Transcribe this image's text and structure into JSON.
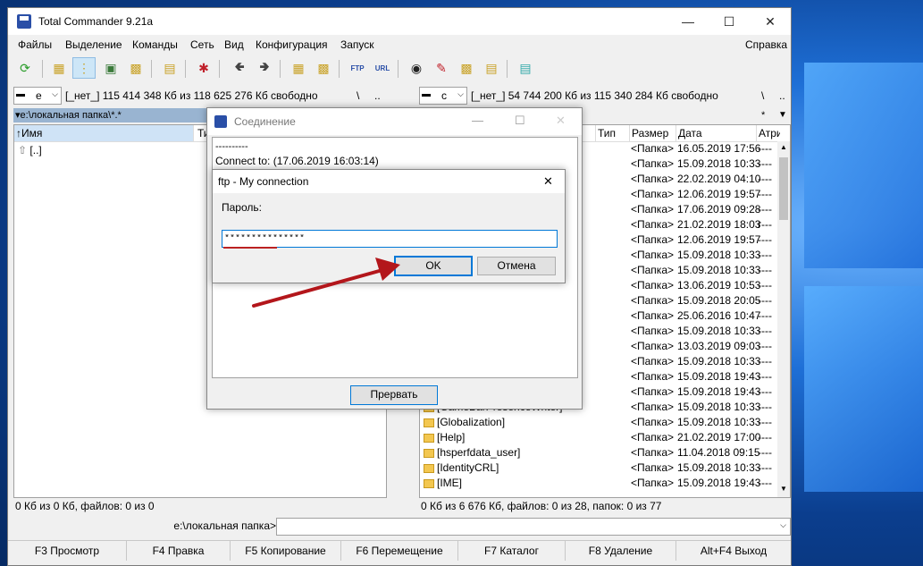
{
  "window": {
    "title": "Total Commander 9.21a"
  },
  "menu": {
    "items": [
      "Файлы",
      "Выделение",
      "Команды",
      "Сеть",
      "Вид",
      "Конфигурация",
      "Запуск"
    ],
    "help": "Справка"
  },
  "left": {
    "drive": "e",
    "drive_info": "[_нет_]  115 414 348 Кб из 118 625 276 Кб свободно",
    "root_btn": "\\",
    "up_btn": "..",
    "path": "▾e:\\локальная папка\\*.*",
    "col_name": "↑Имя",
    "col_type": "Тип",
    "parent_row": "[..]",
    "status": "0 Кб из 0 Кб, файлов: 0 из 0"
  },
  "right": {
    "drive": "c",
    "drive_info": "[_нет_]  54 744 200 Кб из 115 340 284 Кб свободно",
    "root_btn": "\\",
    "up_btn": "..",
    "path_star": "*",
    "col_type": "Тип",
    "col_size": "Размер",
    "col_date": "Дата",
    "col_attr": "Атриб",
    "rows": [
      {
        "name": "",
        "size": "<Папка>",
        "date": "16.05.2019 17:56",
        "attr": "----"
      },
      {
        "name": "",
        "size": "<Папка>",
        "date": "15.09.2018 10:33",
        "attr": "----"
      },
      {
        "name": "",
        "size": "<Папка>",
        "date": "22.02.2019 04:10",
        "attr": "----"
      },
      {
        "name": "",
        "size": "<Папка>",
        "date": "12.06.2019 19:57",
        "attr": "----"
      },
      {
        "name": "",
        "size": "<Папка>",
        "date": "17.06.2019 09:28",
        "attr": "----"
      },
      {
        "name": "",
        "size": "<Папка>",
        "date": "21.02.2019 18:03",
        "attr": "r---"
      },
      {
        "name": "",
        "size": "<Папка>",
        "date": "12.06.2019 19:57",
        "attr": "----"
      },
      {
        "name": "",
        "size": "<Папка>",
        "date": "15.09.2018 10:33",
        "attr": "----"
      },
      {
        "name": "",
        "size": "<Папка>",
        "date": "15.09.2018 10:33",
        "attr": "----"
      },
      {
        "name": "",
        "size": "<Папка>",
        "date": "13.06.2019 10:53",
        "attr": "----"
      },
      {
        "name": "",
        "size": "<Папка>",
        "date": "15.09.2018 20:05",
        "attr": "----"
      },
      {
        "name": "",
        "size": "<Папка>",
        "date": "25.06.2016 10:47",
        "attr": "----"
      },
      {
        "name": "",
        "size": "<Папка>",
        "date": "15.09.2018 10:33",
        "attr": "----"
      },
      {
        "name": "",
        "size": "<Папка>",
        "date": "13.03.2019 09:03",
        "attr": "----"
      },
      {
        "name": "",
        "size": "<Папка>",
        "date": "15.09.2018 10:33",
        "attr": "----"
      },
      {
        "name": "",
        "size": "<Папка>",
        "date": "15.09.2018 19:43",
        "attr": "----"
      },
      {
        "name": "",
        "size": "<Папка>",
        "date": "15.09.2018 19:43",
        "attr": "----"
      },
      {
        "name": "[GameBarPresenceWriter]",
        "size": "<Папка>",
        "date": "15.09.2018 10:33",
        "attr": "----"
      },
      {
        "name": "[Globalization]",
        "size": "<Папка>",
        "date": "15.09.2018 10:33",
        "attr": "----"
      },
      {
        "name": "[Help]",
        "size": "<Папка>",
        "date": "21.02.2019 17:00",
        "attr": "----"
      },
      {
        "name": "[hsperfdata_user]",
        "size": "<Папка>",
        "date": "11.04.2018 09:15",
        "attr": "----"
      },
      {
        "name": "[IdentityCRL]",
        "size": "<Папка>",
        "date": "15.09.2018 10:33",
        "attr": "----"
      },
      {
        "name": "[IME]",
        "size": "<Папка>",
        "date": "15.09.2018 19:43",
        "attr": "----"
      }
    ],
    "status": "0 Кб из 6 676 Кб, файлов: 0 из 28, папок: 0 из 77"
  },
  "cmdline": {
    "label": "e:\\локальная папка>",
    "value": ""
  },
  "fkeys": [
    "F3 Просмотр",
    "F4 Правка",
    "F5 Копирование",
    "F6 Перемещение",
    "F7 Каталог",
    "F8 Удаление",
    "Alt+F4 Выход"
  ],
  "conn_dialog": {
    "title": "Соединение",
    "log1": "----------",
    "log2": "Connect to: (17.06.2019 16:03:14)",
    "abort_label": "Прервать"
  },
  "pwd_dialog": {
    "title": "ftp - My connection",
    "label": "Пароль:",
    "value": "***************",
    "ok_label": "OK",
    "cancel_label": "Отмена",
    "close_glyph": "✕"
  }
}
